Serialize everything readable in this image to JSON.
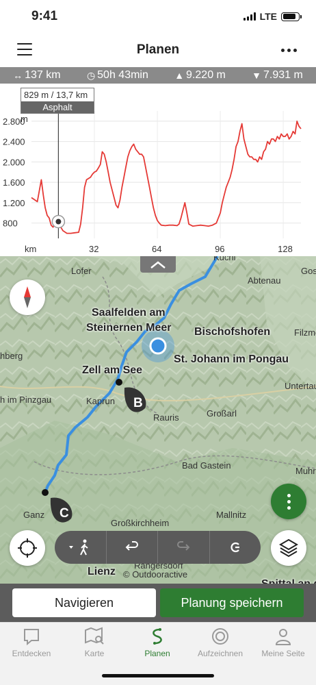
{
  "status_bar": {
    "time": "9:41",
    "network": "LTE"
  },
  "header": {
    "title": "Planen",
    "menu_icon": "hamburger-icon",
    "more_icon": "more-dots-icon"
  },
  "stats": {
    "distance": "137 km",
    "duration": "50h 43min",
    "ascent": "9.220 m",
    "descent": "7.931 m"
  },
  "elevation": {
    "tooltip_value": "829 m / 13,7 km",
    "tooltip_surface": "Asphalt",
    "y_unit": "m",
    "x_unit": "km",
    "y_ticks": [
      "2.800",
      "2.400",
      "2.000",
      "1.600",
      "1.200",
      "800"
    ],
    "x_ticks": [
      "32",
      "64",
      "96",
      "128"
    ]
  },
  "chart_data": {
    "type": "area",
    "title": "",
    "xlabel": "km",
    "ylabel": "m",
    "xlim": [
      0,
      137
    ],
    "ylim": [
      500,
      3000
    ],
    "cursor_km": 13.7,
    "series": [
      {
        "x": [
          0,
          3,
          5,
          6,
          7,
          8,
          9,
          10,
          11,
          12,
          13,
          14,
          16,
          18,
          20,
          22,
          24,
          25,
          26,
          27,
          28,
          30,
          31,
          32,
          33,
          34,
          35,
          36,
          37,
          38,
          39,
          40,
          41,
          42,
          43,
          44,
          45,
          46,
          47,
          48,
          49,
          50,
          51,
          52,
          53,
          54,
          55,
          56,
          57,
          58,
          59,
          60,
          61,
          62,
          63,
          64,
          65,
          66,
          68,
          70,
          72,
          74,
          75,
          76,
          77,
          78,
          79,
          80,
          82,
          84,
          86,
          88,
          90,
          92,
          94,
          95,
          96,
          97,
          98,
          99,
          100,
          101,
          102,
          103,
          104,
          105,
          106,
          107,
          108,
          109,
          110,
          111,
          112,
          113,
          114,
          115,
          116,
          117,
          118,
          119,
          120,
          121,
          122,
          123,
          124,
          125,
          126,
          127,
          128,
          129,
          130,
          131,
          132,
          133,
          134,
          135,
          136,
          137
        ],
        "y": [
          1300,
          1220,
          1650,
          1350,
          1100,
          950,
          900,
          760,
          720,
          800,
          829,
          780,
          650,
          600,
          600,
          610,
          620,
          780,
          1100,
          1500,
          1650,
          1700,
          1760,
          1800,
          1820,
          1880,
          1950,
          2200,
          2150,
          2000,
          1800,
          1600,
          1450,
          1300,
          1150,
          1100,
          1250,
          1500,
          1700,
          1900,
          2100,
          2220,
          2300,
          2350,
          2250,
          2200,
          2150,
          2150,
          2100,
          1900,
          1700,
          1500,
          1300,
          1100,
          950,
          850,
          800,
          760,
          750,
          760,
          760,
          750,
          780,
          900,
          1050,
          1200,
          1000,
          780,
          740,
          750,
          760,
          750,
          740,
          760,
          800,
          900,
          1000,
          1200,
          1350,
          1500,
          1600,
          1700,
          1850,
          2050,
          2300,
          2400,
          2600,
          2750,
          2450,
          2300,
          2150,
          2100,
          2100,
          2050,
          2050,
          2000,
          2100,
          2050,
          2200,
          2250,
          2400,
          2350,
          2450,
          2450,
          2400,
          2500,
          2450,
          2550,
          2500,
          2500,
          2550,
          2450,
          2500,
          2600,
          2550,
          2800,
          2700,
          2650
        ]
      }
    ]
  },
  "map": {
    "labels": {
      "kuchl": "Kuchl",
      "lofer": "Lofer",
      "abtenau": "Abtenau",
      "gosau": "Gosa",
      "saalfelden": "Saalfelden am",
      "saalfelden2": "Steinernen Meer",
      "bischofshofen": "Bischofshofen",
      "filzmoos": "Filzmo",
      "berg": "hberg",
      "st_johann": "St. Johann im Pongau",
      "zell": "Zell am See",
      "untertauern": "Untertau",
      "pinzgau": "h im Pinzgau",
      "kaprun": "Kaprun",
      "rauris": "Rauris",
      "grossarl": "Großarl",
      "bad_gastein": "Bad Gastein",
      "muhr": "Muhr",
      "ganz": "Ganz",
      "grosskirchheim": "Großkirchheim",
      "mallnitz": "Mallnitz",
      "rangersdorf": "Rangersdorf",
      "lienz": "Lienz",
      "spittal": "Spittal an der"
    },
    "markers": {
      "b": "B",
      "c": "C"
    },
    "copyright": "© Outdooractive",
    "accent_route": "#3a8fe0"
  },
  "actions": {
    "navigate": "Navigieren",
    "save": "Planung speichern"
  },
  "tabs": [
    {
      "label": "Entdecken",
      "icon": "chat-bubble-icon"
    },
    {
      "label": "Karte",
      "icon": "map-search-icon"
    },
    {
      "label": "Planen",
      "icon": "route-icon"
    },
    {
      "label": "Aufzeichnen",
      "icon": "record-icon"
    },
    {
      "label": "Meine Seite",
      "icon": "person-icon"
    }
  ],
  "colors": {
    "brand_green": "#2e7d32",
    "profile_line": "#e53935",
    "stats_bar": "#8a8a8a"
  }
}
